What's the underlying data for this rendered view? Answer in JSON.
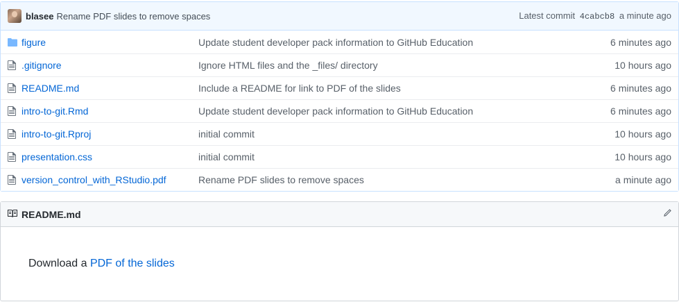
{
  "commit": {
    "author": "blasee",
    "message": "Rename PDF slides to remove spaces",
    "latest_label": "Latest commit",
    "sha": "4cabcb8",
    "age": "a minute ago"
  },
  "files": [
    {
      "type": "folder",
      "name": "figure",
      "message": "Update student developer pack information to GitHub Education",
      "age": "6 minutes ago"
    },
    {
      "type": "file",
      "name": ".gitignore",
      "message": "Ignore HTML files and the _files/ directory",
      "age": "10 hours ago"
    },
    {
      "type": "file",
      "name": "README.md",
      "message": "Include a README for link to PDF of the slides",
      "age": "6 minutes ago"
    },
    {
      "type": "file",
      "name": "intro-to-git.Rmd",
      "message": "Update student developer pack information to GitHub Education",
      "age": "6 minutes ago"
    },
    {
      "type": "file",
      "name": "intro-to-git.Rproj",
      "message": "initial commit",
      "age": "10 hours ago"
    },
    {
      "type": "file",
      "name": "presentation.css",
      "message": "initial commit",
      "age": "10 hours ago"
    },
    {
      "type": "file",
      "name": "version_control_with_RStudio.pdf",
      "message": "Rename PDF slides to remove spaces",
      "age": "a minute ago"
    }
  ],
  "readme": {
    "title": "README.md",
    "body_prefix": "Download a",
    "body_link": "PDF of the slides"
  },
  "icons": {
    "folder": "folder-icon",
    "file": "file-icon",
    "book": "book-icon",
    "edit": "pencil-icon"
  },
  "colors": {
    "link": "#0366d6",
    "folder": "#79b8ff",
    "commit_bar_bg": "#f1f8ff"
  }
}
